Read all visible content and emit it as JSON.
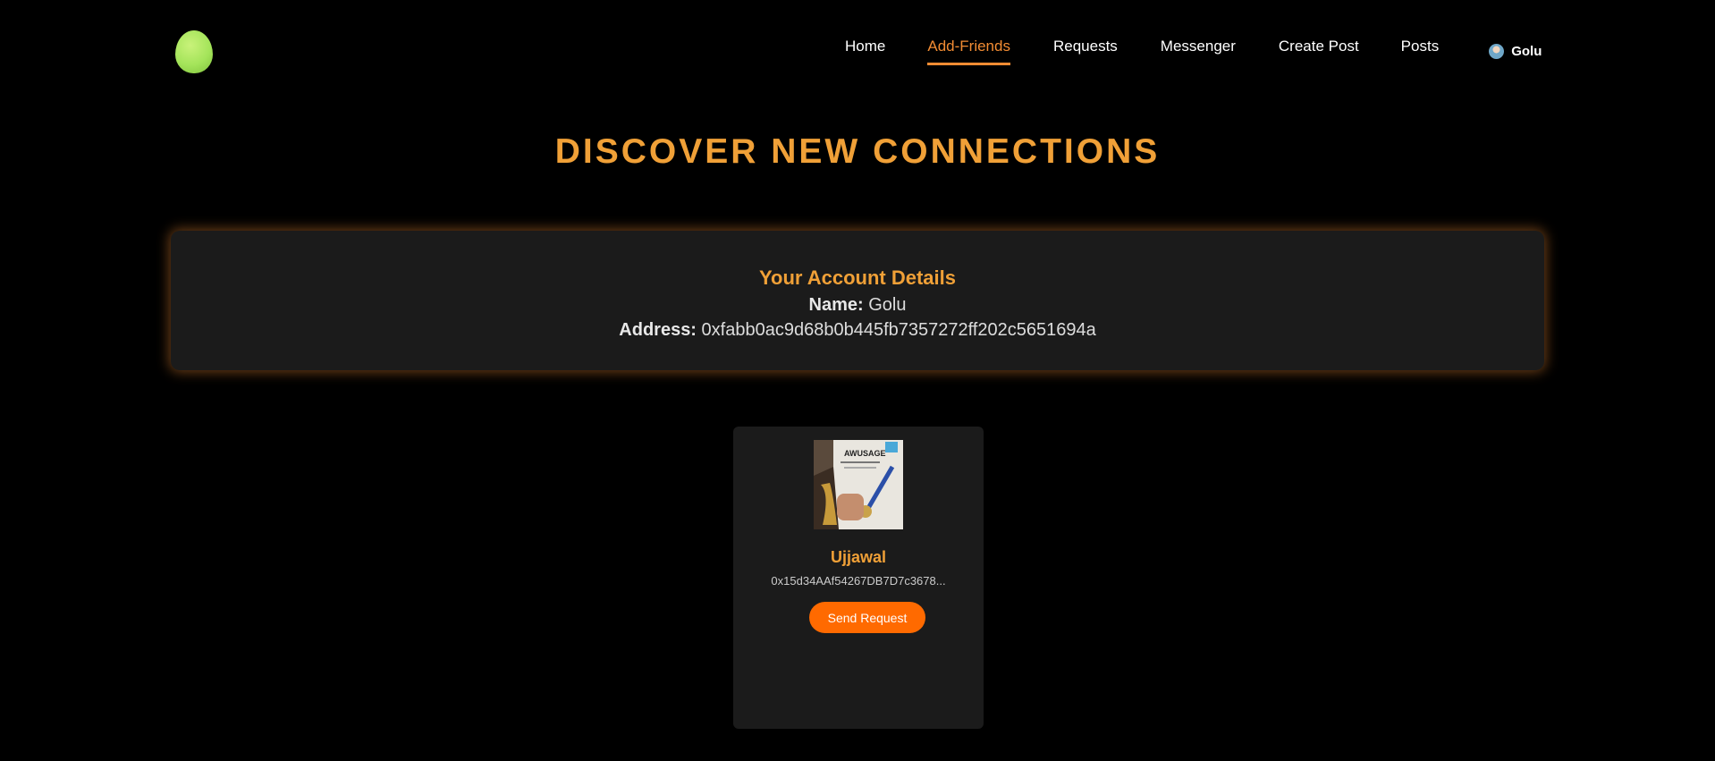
{
  "nav": {
    "items": [
      {
        "label": "Home"
      },
      {
        "label": "Add-Friends"
      },
      {
        "label": "Requests"
      },
      {
        "label": "Messenger"
      },
      {
        "label": "Create Post"
      },
      {
        "label": "Posts"
      }
    ],
    "user_name": "Golu"
  },
  "page": {
    "title": "DISCOVER NEW CONNECTIONS"
  },
  "account": {
    "title": "Your Account Details",
    "name_label": "Name:",
    "name_value": "Golu",
    "address_label": "Address:",
    "address_value": "0xfabb0ac9d68b0b445fb7357272ff202c5651694a"
  },
  "friends": [
    {
      "name": "Ujjawal",
      "address": "0x15d34AAf54267DB7D7c3678...",
      "button_label": "Send Request",
      "photo_text": "AWUSAGE"
    }
  ],
  "colors": {
    "background": "#000000",
    "accent": "#f0a037",
    "nav_active": "#f28c33",
    "button": "#ff6a00",
    "card": "#1b1b1b"
  },
  "icons": {
    "logo": "balloon-logo-icon",
    "user": "user-avatar-icon"
  }
}
